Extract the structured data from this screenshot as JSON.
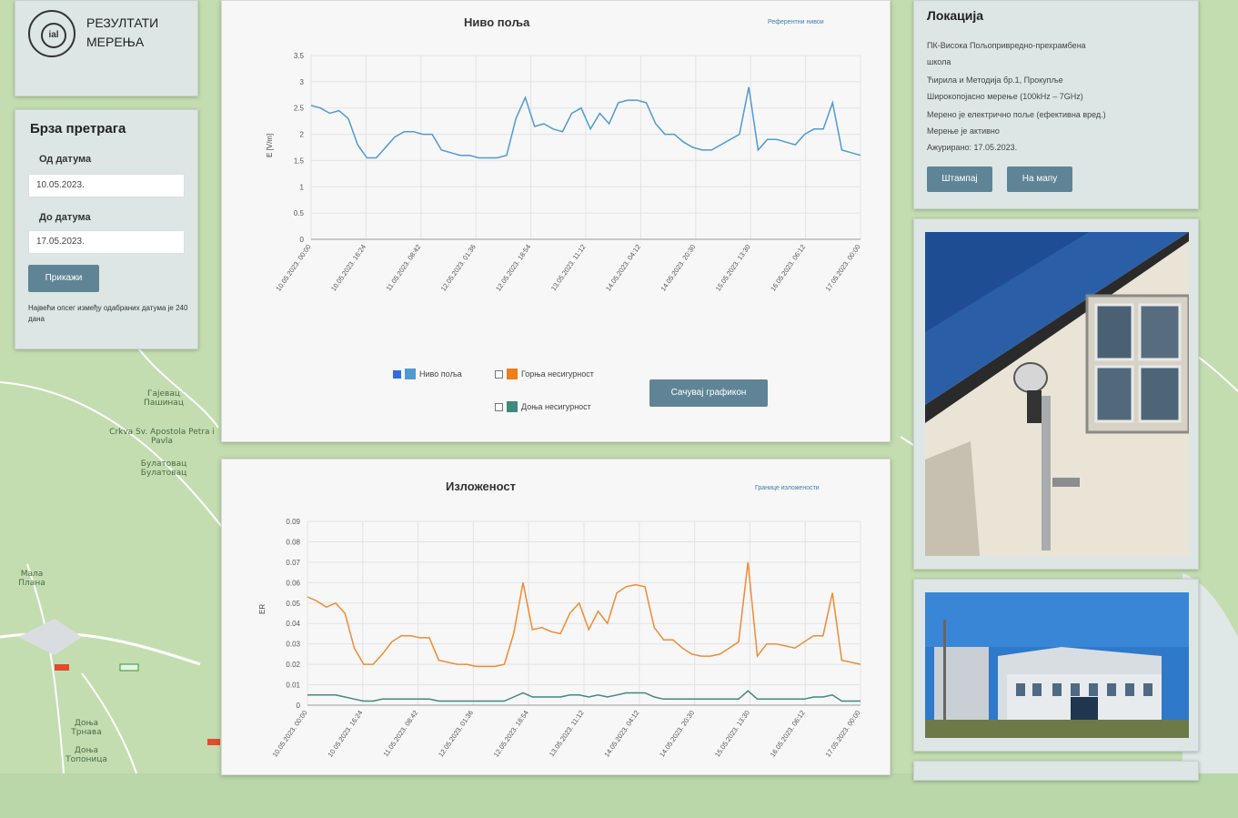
{
  "logo": {
    "title_line1": "РЕЗУЛТАТИ",
    "title_line2": "МЕРЕЊА",
    "emblem": "ial"
  },
  "search": {
    "title": "Брза претрага",
    "from_label": "Од датума",
    "from_value": "10.05.2023.",
    "to_label": "До датума",
    "to_value": "17.05.2023.",
    "show_button": "Прикажи",
    "note": "Највећи опсег између одабраних датума је 240 дана"
  },
  "field_chart": {
    "title": "Ниво поља",
    "link": "Референтни нивои",
    "ylabel": "E [V/m]",
    "legend": {
      "level": "Ниво поља",
      "upper": "Горња несигурност",
      "lower": "Доња несигурност"
    },
    "save_button": "Сачувај графикон"
  },
  "exposure_chart": {
    "title": "Изложеност",
    "link": "Границе изложености",
    "ylabel": "ER"
  },
  "location": {
    "title": "Локација",
    "lines": [
      "ПК-Висока Пољопривредно-прехрамбена",
      "школа",
      "Ћирила и Методија бр.1, Прокупље",
      "Широкопојасно мерење (100kHz – 7GHz)",
      "Мерено је електрично поље (ефективна вред.)",
      "Мерење је активно",
      "Ажурирано: 17.05.2023."
    ],
    "print_button": "Штампај",
    "map_button": "На мапу"
  },
  "map_labels": [
    "Гајевац Пашинац",
    "Crkva Sv. Apostola Petra i Pavla",
    "Булатовац Булатовац",
    "Мала Плана",
    "Доња Трнава",
    "Доња Топоница"
  ],
  "chart_data": [
    {
      "type": "line",
      "title": "Ниво поља",
      "ylabel": "E [V/m]",
      "ylim": [
        0,
        3.5
      ],
      "yticks": [
        0,
        0.5,
        1.0,
        1.5,
        2.0,
        2.5,
        3.0,
        3.5
      ],
      "xticks": [
        "10.05.2023. 00:00",
        "10.05.2023. 16:24",
        "11.05.2023. 08:42",
        "12.05.2023. 01:36",
        "12.05.2023. 18:54",
        "13.05.2023. 11:12",
        "14.05.2023. 04:12",
        "14.05.2023. 20:30",
        "15.05.2023. 13:30",
        "16.05.2023. 06:12",
        "17.05.2023. 00:00"
      ],
      "series": [
        {
          "name": "Ниво поља",
          "color": "#4f9ad3",
          "values": [
            2.55,
            2.5,
            2.4,
            2.45,
            2.3,
            1.8,
            1.55,
            1.55,
            1.75,
            1.95,
            2.05,
            2.05,
            2.0,
            2.0,
            1.7,
            1.65,
            1.6,
            1.6,
            1.55,
            1.55,
            1.55,
            1.6,
            2.3,
            2.7,
            2.15,
            2.2,
            2.1,
            2.05,
            2.4,
            2.5,
            2.1,
            2.4,
            2.2,
            2.6,
            2.65,
            2.65,
            2.6,
            2.2,
            2.0,
            2.0,
            1.85,
            1.75,
            1.7,
            1.7,
            1.8,
            1.9,
            2.0,
            2.9,
            1.7,
            1.9,
            1.9,
            1.85,
            1.8,
            2.0,
            2.1,
            2.1,
            2.6,
            1.7,
            1.65,
            1.6
          ]
        }
      ]
    },
    {
      "type": "line",
      "title": "Изложеност",
      "ylabel": "ER",
      "ylim": [
        0,
        0.09
      ],
      "yticks": [
        0,
        0.01,
        0.02,
        0.03,
        0.04,
        0.05,
        0.06,
        0.07,
        0.08,
        0.09
      ],
      "xticks": [
        "10.05.2023. 00:00",
        "10.05.2023. 16:24",
        "11.05.2023. 08:42",
        "12.05.2023. 01:36",
        "12.05.2023. 18:54",
        "13.05.2023. 11:12",
        "14.05.2023. 04:12",
        "14.05.2023. 20:30",
        "15.05.2023. 13:30",
        "16.05.2023. 06:12",
        "17.05.2023. 00:00"
      ],
      "series": [
        {
          "name": "Горња несигурност",
          "color": "#ef8b35",
          "values": [
            0.053,
            0.051,
            0.048,
            0.05,
            0.045,
            0.028,
            0.02,
            0.02,
            0.025,
            0.031,
            0.034,
            0.034,
            0.033,
            0.033,
            0.022,
            0.021,
            0.02,
            0.02,
            0.019,
            0.019,
            0.019,
            0.02,
            0.035,
            0.06,
            0.037,
            0.038,
            0.036,
            0.035,
            0.045,
            0.05,
            0.037,
            0.046,
            0.04,
            0.055,
            0.058,
            0.059,
            0.058,
            0.038,
            0.032,
            0.032,
            0.028,
            0.025,
            0.024,
            0.024,
            0.025,
            0.028,
            0.031,
            0.07,
            0.024,
            0.03,
            0.03,
            0.029,
            0.028,
            0.031,
            0.034,
            0.034,
            0.055,
            0.022,
            0.021,
            0.02
          ]
        },
        {
          "name": "Доња несигурност",
          "color": "#3f8a7a",
          "values": [
            0.005,
            0.005,
            0.005,
            0.005,
            0.004,
            0.003,
            0.002,
            0.002,
            0.003,
            0.003,
            0.003,
            0.003,
            0.003,
            0.003,
            0.002,
            0.002,
            0.002,
            0.002,
            0.002,
            0.002,
            0.002,
            0.002,
            0.004,
            0.006,
            0.004,
            0.004,
            0.004,
            0.004,
            0.005,
            0.005,
            0.004,
            0.005,
            0.004,
            0.005,
            0.006,
            0.006,
            0.006,
            0.004,
            0.003,
            0.003,
            0.003,
            0.003,
            0.003,
            0.003,
            0.003,
            0.003,
            0.003,
            0.007,
            0.003,
            0.003,
            0.003,
            0.003,
            0.003,
            0.003,
            0.004,
            0.004,
            0.005,
            0.002,
            0.002,
            0.002
          ]
        }
      ]
    }
  ]
}
